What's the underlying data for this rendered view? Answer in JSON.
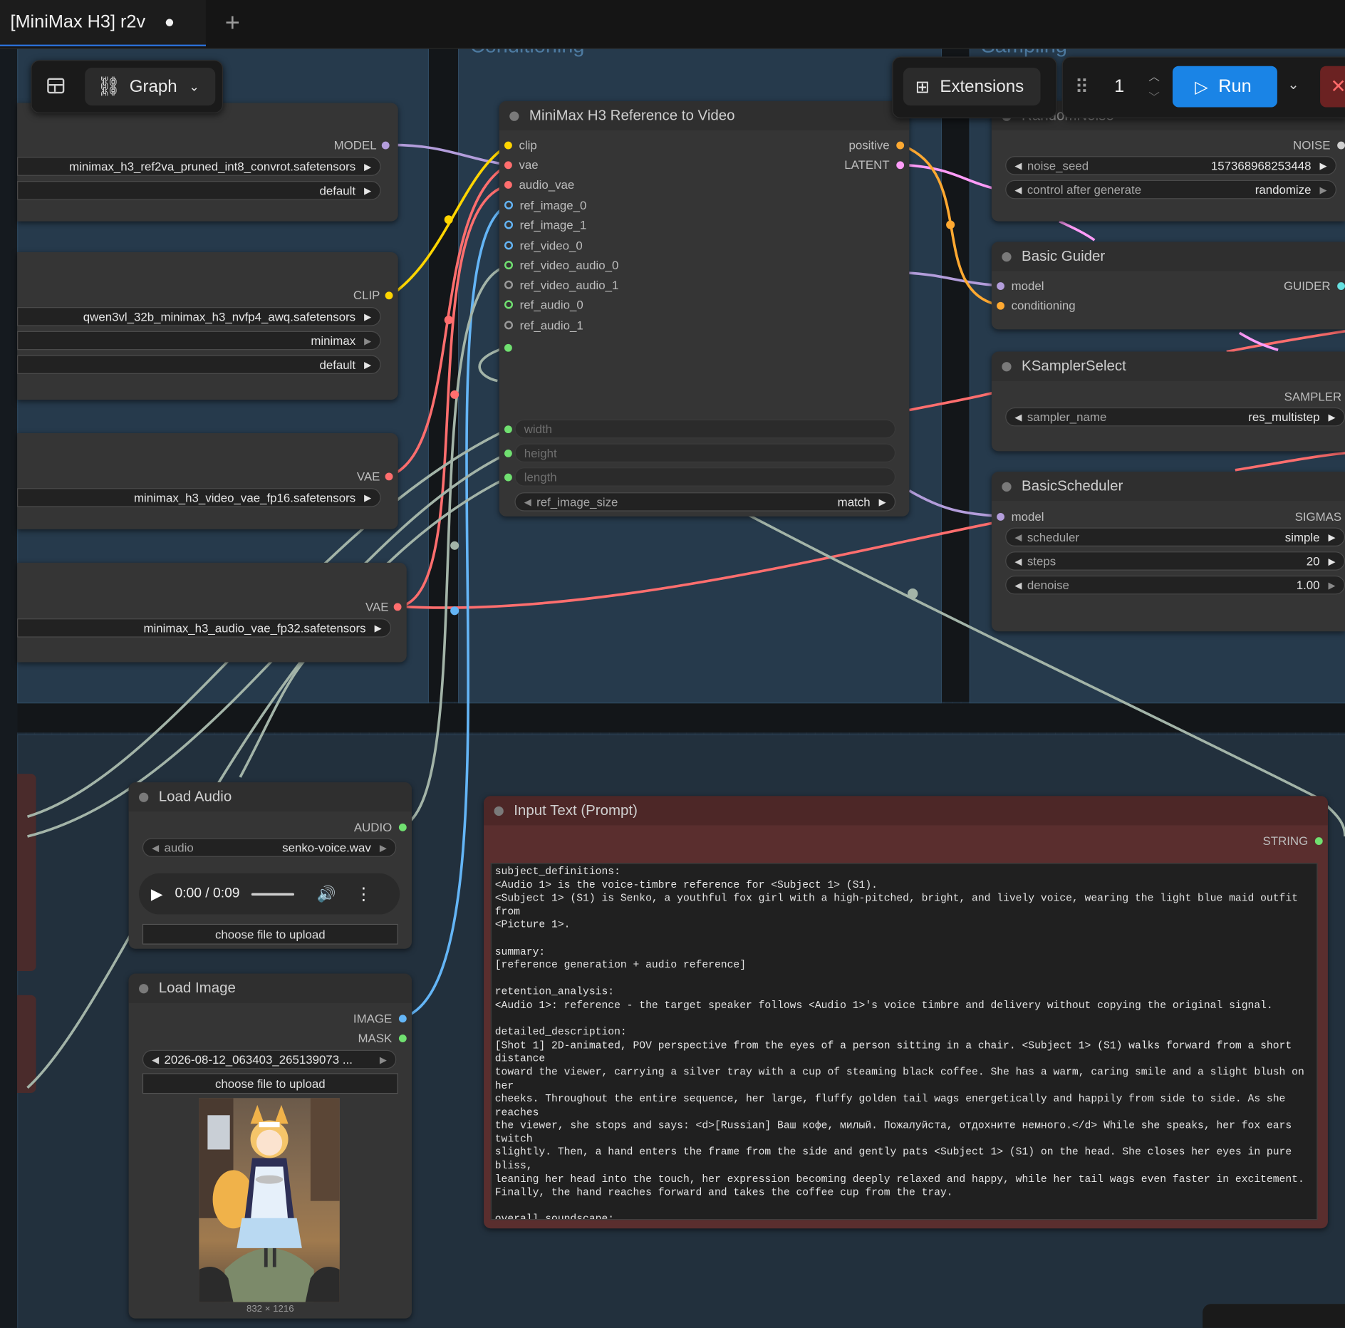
{
  "tab": {
    "title": "[MiniMax H3] r2v",
    "modified_marker": "●",
    "add_label": "+"
  },
  "toolbar": {
    "graph_label": "Graph",
    "extensions_label": "Extensions",
    "batch_count": "1",
    "run_label": "Run"
  },
  "groups": {
    "conditioning": "Conditioning",
    "sampling": "Sampling"
  },
  "loader_model": {
    "output": "MODEL",
    "unet_name": "minimax_h3_ref2va_pruned_int8_convrot.safetensors",
    "weight_dtype": "default"
  },
  "loader_clip": {
    "output": "CLIP",
    "clip_name": "qwen3vl_32b_minimax_h3_nvfp4_awq.safetensors",
    "type": "minimax",
    "device": "default"
  },
  "loader_vae": {
    "output": "VAE",
    "vae_name": "minimax_h3_video_vae_fp16.safetensors"
  },
  "loader_audio_vae": {
    "output": "VAE",
    "vae_name": "minimax_h3_audio_vae_fp32.safetensors"
  },
  "ref_node": {
    "title": "MiniMax H3 Reference to Video",
    "inputs": [
      "clip",
      "vae",
      "audio_vae",
      "ref_image_0",
      "ref_image_1",
      "ref_video_0",
      "ref_video_audio_0",
      "ref_video_audio_1",
      "ref_audio_0",
      "ref_audio_1"
    ],
    "outputs": [
      "positive",
      "LATENT"
    ],
    "width_label": "width",
    "height_label": "height",
    "length_label": "length",
    "ref_image_size_label": "ref_image_size",
    "ref_image_size_value": "match"
  },
  "random_noise": {
    "title": "RandomNoise",
    "output": "NOISE",
    "noise_seed_label": "noise_seed",
    "noise_seed_value": "157368968253448",
    "control_label": "control after generate",
    "control_value": "randomize"
  },
  "basic_guider": {
    "title": "Basic Guider",
    "in_model": "model",
    "in_conditioning": "conditioning",
    "output": "GUIDER"
  },
  "ksampler_select": {
    "title": "KSamplerSelect",
    "output": "SAMPLER",
    "sampler_label": "sampler_name",
    "sampler_value": "res_multistep"
  },
  "basic_scheduler": {
    "title": "BasicScheduler",
    "in_model": "model",
    "output": "SIGMAS",
    "scheduler_label": "scheduler",
    "scheduler_value": "simple",
    "steps_label": "steps",
    "steps_value": "20",
    "denoise_label": "denoise",
    "denoise_value": "1.00"
  },
  "load_audio": {
    "title": "Load Audio",
    "output": "AUDIO",
    "audio_label": "audio",
    "audio_value": "senko-voice.wav",
    "time": "0:00 / 0:09",
    "upload_label": "choose file to upload"
  },
  "load_image": {
    "title": "Load Image",
    "out_image": "IMAGE",
    "out_mask": "MASK",
    "image_value": "2026-08-12_063403_265139073 ...",
    "upload_label": "choose file to upload",
    "dimensions": "832 × 1216"
  },
  "input_text": {
    "title": "Input Text (Prompt)",
    "output": "STRING",
    "text": "subject_definitions:\n<Audio 1> is the voice-timbre reference for <Subject 1> (S1).\n<Subject 1> (S1) is Senko, a youthful fox girl with a high-pitched, bright, and lively voice, wearing the light blue maid outfit from\n<Picture 1>.\n\nsummary:\n[reference generation + audio reference]\n\nretention_analysis:\n<Audio 1>: reference - the target speaker follows <Audio 1>'s voice timbre and delivery without copying the original signal.\n\ndetailed_description:\n[Shot 1] 2D-animated, POV perspective from the eyes of a person sitting in a chair. <Subject 1> (S1) walks forward from a short distance\ntoward the viewer, carrying a silver tray with a cup of steaming black coffee. She has a warm, caring smile and a slight blush on her\ncheeks. Throughout the entire sequence, her large, fluffy golden tail wags energetically and happily from side to side. As she reaches\nthe viewer, she stops and says: <d>[Russian] Ваш кофе, милый. Пожалуйста, отдохните немного.</d> While she speaks, her fox ears twitch\nslightly. Then, a hand enters the frame from the side and gently pats <Subject 1> (S1) on the head. She closes her eyes in pure bliss,\nleaning her head into the touch, her expression becoming deeply relaxed and happy, while her tail wags even faster in excitement.\nFinally, the hand reaches forward and takes the coffee cup from the tray.\n\noverall_soundscape:\nSoft footsteps on a wooden floor, the delicate clink of a porcelain cup on a metal tray, a soft, contented hum from Senko during the\nhead pat, and a cozy, quiet indoor ambience.\n\nnon_diegetic_music:\nA gentle, slow-tempo acoustic piano melody, heartwarming and peaceful."
  },
  "colors": {
    "model": "#b39ddb",
    "clip": "#ffd500",
    "vae": "#ff6e6e",
    "image": "#64b5f6",
    "audio": "#70e070",
    "latent": "#ff9cf9",
    "conditioning": "#ffa931",
    "run": "#1a84e6",
    "generic_wire": "#a3b4a8"
  }
}
